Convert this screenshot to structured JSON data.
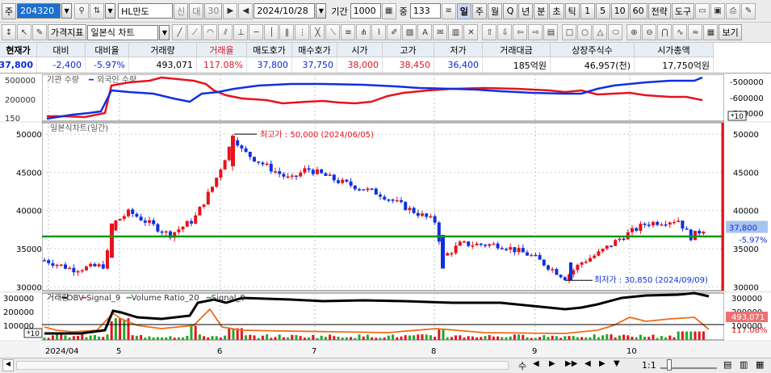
{
  "toolbar1": {
    "code_label": "주",
    "code": "204320",
    "name": "HL만도",
    "new_label": "신",
    "tag_label": "대",
    "tag_value": "30",
    "date": "2024/10/28",
    "period_label": "기간",
    "period": "1000",
    "zoom_label": "중",
    "zoom": "133",
    "periods": [
      "일",
      "주",
      "월",
      "Q",
      "년",
      "분",
      "초",
      "틱",
      "1",
      "5",
      "10",
      "60"
    ],
    "strategy": "전략",
    "tools": "도구"
  },
  "toolbar2": {
    "indicator": "가격지표",
    "chart_type": "일본식 차트",
    "view_label": "보기"
  },
  "quote": {
    "headers": [
      "현재가",
      "대비",
      "대비율",
      "거래량",
      "거래율",
      "매도호가",
      "매수호가",
      "시가",
      "고가",
      "저가",
      "거래대금",
      "상장주식수",
      "시가총액"
    ],
    "values": [
      "37,800",
      "-2,400",
      "-5.97%",
      "493,071",
      "117.08%",
      "37,800",
      "37,750",
      "38,000",
      "38,450",
      "36,400",
      "185억원",
      "46,957(천)",
      "17,750억원"
    ]
  },
  "chart_data": [
    {
      "type": "line",
      "title": "기관 수량 ━ 외국인 수량",
      "series": [
        {
          "name": "기관 수량",
          "color": "#e8121d"
        },
        {
          "name": "외국인 수량",
          "color": "#1030e0"
        }
      ],
      "left_ticks": [
        "500000",
        "200000",
        "150"
      ],
      "right_ticks": [
        "-500000",
        "-600000",
        "-700000"
      ],
      "scale_label": "*10"
    },
    {
      "type": "candlestick",
      "title": "일본식차트(일간)",
      "y_ticks": [
        50000,
        45000,
        40000,
        35000,
        30000
      ],
      "ylim": [
        29500,
        51500
      ],
      "x_ticks": [
        "2024/04",
        "5",
        "6",
        "7",
        "8",
        "9",
        "10"
      ],
      "support_line": 36600,
      "high_label": "최고가 : 50,000 (2024/06/05)",
      "low_label": "최저가 : 30,850 (2024/09/09)",
      "price_tag": "37,800",
      "pct_tag": "-5.97%"
    },
    {
      "type": "line",
      "title": "거래량 ━ OBV ━ Signal_9 ━ Volume Ratio_20 ━ Signal_9",
      "series": [
        {
          "name": "거래량",
          "color": "#e8121d"
        },
        {
          "name": "OBV",
          "color": "#000000"
        },
        {
          "name": "Signal_9",
          "color": "#e8121d"
        },
        {
          "name": "Volume Ratio_20",
          "color": "#22aa22"
        },
        {
          "name": "Signal_9",
          "color": "#22aa22"
        }
      ],
      "y_ticks": [
        "300000",
        "200000",
        "100000"
      ],
      "vol_tag": "493,071",
      "ratio_tag": "117.08%",
      "scale_label": "*10"
    }
  ],
  "bottom": {
    "scale": "1:1"
  },
  "colors": {
    "up": "#e8121d",
    "down": "#1030e0",
    "support": "#119911",
    "orange": "#ee6a1a"
  }
}
